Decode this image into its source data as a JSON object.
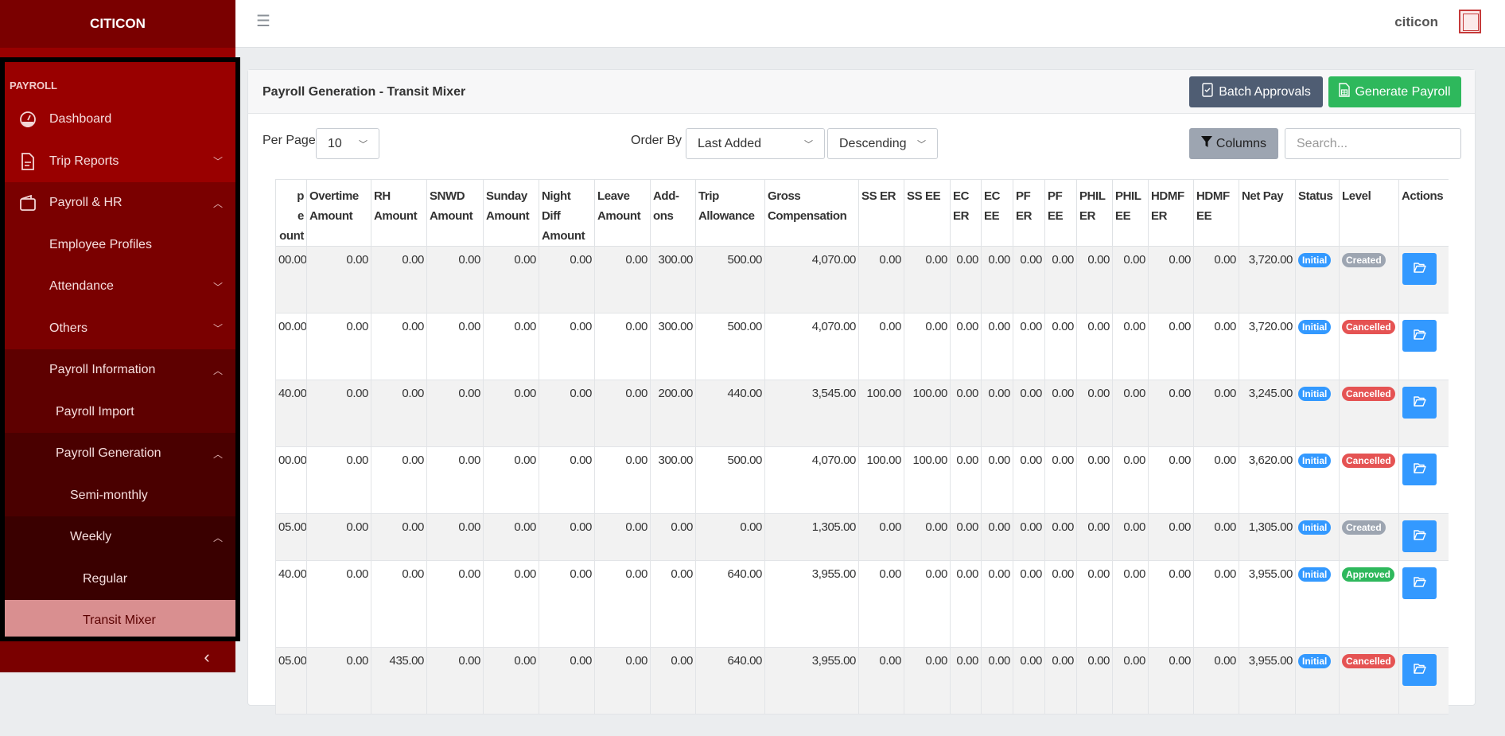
{
  "brand": "CITICON",
  "sidebar": {
    "section": "PAYROLL",
    "items": [
      {
        "label": "Dashboard"
      },
      {
        "label": "Trip Reports"
      },
      {
        "label": "Payroll & HR"
      },
      {
        "label": "Employee Profiles"
      },
      {
        "label": "Attendance"
      },
      {
        "label": "Others"
      },
      {
        "label": "Payroll Information"
      },
      {
        "label": "Payroll Import"
      },
      {
        "label": "Payroll Generation"
      },
      {
        "label": "Semi-monthly"
      },
      {
        "label": "Weekly"
      },
      {
        "label": "Regular"
      },
      {
        "label": "Transit Mixer"
      }
    ],
    "collapse": "‹"
  },
  "topbar": {
    "user": "citicon"
  },
  "card": {
    "title": "Payroll Generation - Transit Mixer",
    "batch_label": "Batch Approvals",
    "generate_label": "Generate Payroll",
    "per_page_label": "Per Page",
    "per_page_value": "10",
    "order_by_label": "Order By",
    "order_by_value": "Last Added",
    "direction_value": "Descending",
    "columns_label": "Columns",
    "search_placeholder": "Search..."
  },
  "colors": {
    "initial": "#3399ff",
    "created": "#9da5b1",
    "cancelled": "#e55353",
    "approved": "#2eb85c"
  },
  "table": {
    "headers": [
      "p e ount",
      "Overtime Amount",
      "RH Amount",
      "SNWD Amount",
      "Sunday Amount",
      "Night Diff Amount",
      "Leave Amount",
      "Add-ons",
      "Trip Allowance",
      "Gross Compensation",
      "SS ER",
      "SS EE",
      "EC ER",
      "EC EE",
      "PF ER",
      "PF EE",
      "PHIL ER",
      "PHIL EE",
      "HDMF ER",
      "HDMF EE",
      "Net Pay",
      "Status",
      "Level",
      "Actions"
    ],
    "rows": [
      {
        "values": [
          "00.00",
          "0.00",
          "0.00",
          "0.00",
          "0.00",
          "0.00",
          "0.00",
          "300.00",
          "500.00",
          "4,070.00",
          "0.00",
          "0.00",
          "0.00",
          "0.00",
          "0.00",
          "0.00",
          "0.00",
          "0.00",
          "0.00",
          "0.00",
          "3,720.00"
        ],
        "status": "Initial",
        "level": "Created"
      },
      {
        "values": [
          "00.00",
          "0.00",
          "0.00",
          "0.00",
          "0.00",
          "0.00",
          "0.00",
          "300.00",
          "500.00",
          "4,070.00",
          "0.00",
          "0.00",
          "0.00",
          "0.00",
          "0.00",
          "0.00",
          "0.00",
          "0.00",
          "0.00",
          "0.00",
          "3,720.00"
        ],
        "status": "Initial",
        "level": "Cancelled"
      },
      {
        "values": [
          "40.00",
          "0.00",
          "0.00",
          "0.00",
          "0.00",
          "0.00",
          "0.00",
          "200.00",
          "440.00",
          "3,545.00",
          "100.00",
          "100.00",
          "0.00",
          "0.00",
          "0.00",
          "0.00",
          "0.00",
          "0.00",
          "0.00",
          "0.00",
          "3,245.00"
        ],
        "status": "Initial",
        "level": "Cancelled"
      },
      {
        "values": [
          "00.00",
          "0.00",
          "0.00",
          "0.00",
          "0.00",
          "0.00",
          "0.00",
          "300.00",
          "500.00",
          "4,070.00",
          "100.00",
          "100.00",
          "0.00",
          "0.00",
          "0.00",
          "0.00",
          "0.00",
          "0.00",
          "0.00",
          "0.00",
          "3,620.00"
        ],
        "status": "Initial",
        "level": "Cancelled"
      },
      {
        "values": [
          "05.00",
          "0.00",
          "0.00",
          "0.00",
          "0.00",
          "0.00",
          "0.00",
          "0.00",
          "0.00",
          "1,305.00",
          "0.00",
          "0.00",
          "0.00",
          "0.00",
          "0.00",
          "0.00",
          "0.00",
          "0.00",
          "0.00",
          "0.00",
          "1,305.00"
        ],
        "status": "Initial",
        "level": "Created"
      },
      {
        "values": [
          "40.00",
          "0.00",
          "0.00",
          "0.00",
          "0.00",
          "0.00",
          "0.00",
          "0.00",
          "640.00",
          "3,955.00",
          "0.00",
          "0.00",
          "0.00",
          "0.00",
          "0.00",
          "0.00",
          "0.00",
          "0.00",
          "0.00",
          "0.00",
          "3,955.00"
        ],
        "status": "Initial",
        "level": "Approved"
      },
      {
        "values": [
          "05.00",
          "0.00",
          "435.00",
          "0.00",
          "0.00",
          "0.00",
          "0.00",
          "0.00",
          "640.00",
          "3,955.00",
          "0.00",
          "0.00",
          "0.00",
          "0.00",
          "0.00",
          "0.00",
          "0.00",
          "0.00",
          "0.00",
          "0.00",
          "3,955.00"
        ],
        "status": "Initial",
        "level": "Cancelled"
      }
    ]
  }
}
